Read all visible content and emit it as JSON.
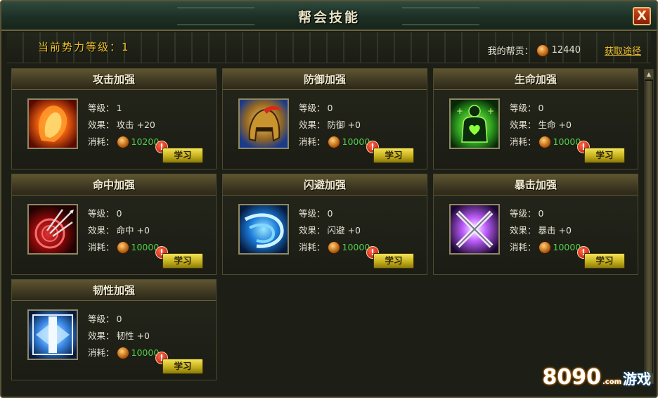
{
  "window": {
    "title": "帮会技能"
  },
  "close_button": {
    "label": "X"
  },
  "info": {
    "power_label": "当前势力等级：",
    "power_level": "1",
    "contrib_label": "我的帮贡：",
    "contrib_value": "12440",
    "obtain_link": "获取途径"
  },
  "skills": [
    {
      "name": "攻击加强",
      "level_label": "等级：",
      "level": "1",
      "effect_label": "效果：",
      "effect": "攻击 +20",
      "cost_label": "消耗：",
      "cost": "10200",
      "button": "学习",
      "warn": "!",
      "icon": "fire-fist-icon"
    },
    {
      "name": "防御加强",
      "level_label": "等级：",
      "level": "0",
      "effect_label": "效果：",
      "effect": "防御 +0",
      "cost_label": "消耗：",
      "cost": "10000",
      "button": "学习",
      "warn": "!",
      "icon": "helmet-icon"
    },
    {
      "name": "生命加强",
      "level_label": "等级：",
      "level": "0",
      "effect_label": "效果：",
      "effect": "生命 +0",
      "cost_label": "消耗：",
      "cost": "10000",
      "button": "学习",
      "warn": "!",
      "icon": "heart-body-icon"
    },
    {
      "name": "命中加强",
      "level_label": "等级：",
      "level": "0",
      "effect_label": "效果：",
      "effect": "命中 +0",
      "cost_label": "消耗：",
      "cost": "10000",
      "button": "学习",
      "warn": "!",
      "icon": "arrows-target-icon"
    },
    {
      "name": "闪避加强",
      "level_label": "等级：",
      "level": "0",
      "effect_label": "效果：",
      "effect": "闪避 +0",
      "cost_label": "消耗：",
      "cost": "10000",
      "button": "学习",
      "warn": "!",
      "icon": "blue-swirl-icon"
    },
    {
      "name": "暴击加强",
      "level_label": "等级：",
      "level": "0",
      "effect_label": "效果：",
      "effect": "暴击 +0",
      "cost_label": "消耗：",
      "cost": "10000",
      "button": "学习",
      "warn": "!",
      "icon": "crossed-blades-icon"
    },
    {
      "name": "韧性加强",
      "level_label": "等级：",
      "level": "0",
      "effect_label": "效果：",
      "effect": "韧性 +0",
      "cost_label": "消耗：",
      "cost": "10000",
      "button": "学习",
      "warn": "!",
      "icon": "ice-rune-icon"
    }
  ],
  "watermark": {
    "brand": "8090",
    "domain": ".com",
    "game": "游戏"
  },
  "colors": {
    "accent_gold": "#f2c22c",
    "cost_green": "#4fd04a",
    "panel_bg": "#1d1f16"
  }
}
